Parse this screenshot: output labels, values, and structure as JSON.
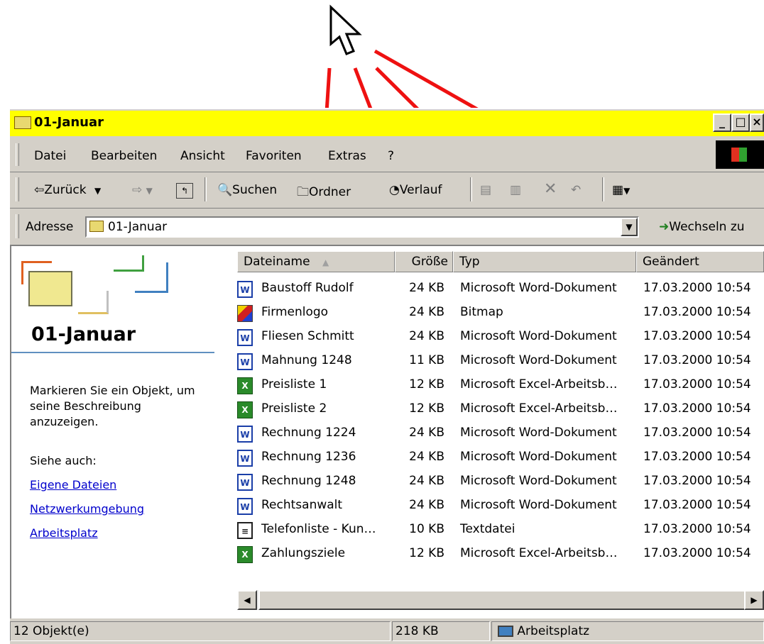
{
  "window": {
    "title": "01-Januar",
    "controls": [
      "_",
      "□",
      "×"
    ]
  },
  "menu": {
    "items": [
      "Datei",
      "Bearbeiten",
      "Ansicht",
      "Favoriten",
      "Extras",
      "?"
    ]
  },
  "toolbar": {
    "back": "Zurück",
    "search": "Suchen",
    "folders": "Ordner",
    "history": "Verlauf"
  },
  "address": {
    "label": "Adresse",
    "value": "01-Januar",
    "go": "Wechseln zu"
  },
  "sidepanel": {
    "title": "01-Januar",
    "hint": "Markieren Sie ein Objekt, um seine Beschreibung anzuzeigen.",
    "see_also": "Siehe auch:",
    "links": [
      "Eigene Dateien",
      "Netzwerkumgebung",
      "Arbeitsplatz"
    ]
  },
  "columns": {
    "name": "Dateiname",
    "size": "Größe",
    "type": "Typ",
    "modified": "Geändert"
  },
  "files": [
    {
      "icon": "word-document-icon",
      "name": "Baustoff Rudolf",
      "size": "24 KB",
      "type": "Microsoft Word-Dokument",
      "modified": "17.03.2000 10:54"
    },
    {
      "icon": "bitmap-image-icon",
      "name": "Firmenlogo",
      "size": "24 KB",
      "type": "Bitmap",
      "modified": "17.03.2000 10:54"
    },
    {
      "icon": "word-document-icon",
      "name": "Fliesen Schmitt",
      "size": "24 KB",
      "type": "Microsoft Word-Dokument",
      "modified": "17.03.2000 10:54"
    },
    {
      "icon": "word-document-icon",
      "name": "Mahnung 1248",
      "size": "11 KB",
      "type": "Microsoft Word-Dokument",
      "modified": "17.03.2000 10:54"
    },
    {
      "icon": "excel-workbook-icon",
      "name": "Preisliste 1",
      "size": "12 KB",
      "type": "Microsoft Excel-Arbeitsb…",
      "modified": "17.03.2000 10:54"
    },
    {
      "icon": "excel-workbook-icon",
      "name": "Preisliste 2",
      "size": "12 KB",
      "type": "Microsoft Excel-Arbeitsb…",
      "modified": "17.03.2000 10:54"
    },
    {
      "icon": "word-document-icon",
      "name": "Rechnung 1224",
      "size": "24 KB",
      "type": "Microsoft Word-Dokument",
      "modified": "17.03.2000 10:54"
    },
    {
      "icon": "word-document-icon",
      "name": "Rechnung 1236",
      "size": "24 KB",
      "type": "Microsoft Word-Dokument",
      "modified": "17.03.2000 10:54"
    },
    {
      "icon": "word-document-icon",
      "name": "Rechnung 1248",
      "size": "24 KB",
      "type": "Microsoft Word-Dokument",
      "modified": "17.03.2000 10:54"
    },
    {
      "icon": "word-document-icon",
      "name": "Rechtsanwalt",
      "size": "24 KB",
      "type": "Microsoft Word-Dokument",
      "modified": "17.03.2000 10:54"
    },
    {
      "icon": "text-file-icon",
      "name": "Telefonliste - Kun…",
      "size": "10 KB",
      "type": "Textdatei",
      "modified": "17.03.2000 10:54"
    },
    {
      "icon": "excel-workbook-icon",
      "name": "Zahlungsziele",
      "size": "12 KB",
      "type": "Microsoft Excel-Arbeitsb…",
      "modified": "17.03.2000 10:54"
    }
  ],
  "status": {
    "count": "12 Objekt(e)",
    "size": "218 KB",
    "zone": "Arbeitsplatz"
  },
  "colors": {
    "titlebar": "#ffff00",
    "annotation_arrows": "#ee1111",
    "link": "#0000cc"
  }
}
